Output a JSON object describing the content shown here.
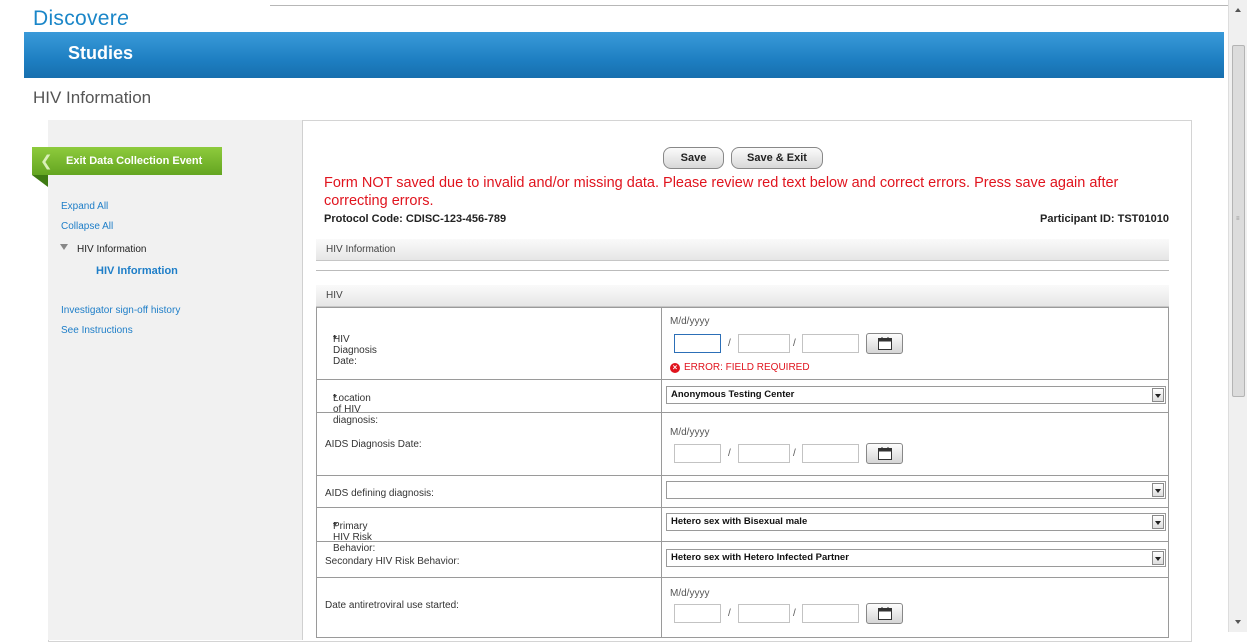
{
  "app": {
    "logo_main": "Discover",
    "logo_accent": "e",
    "banner_title": "Studies"
  },
  "page": {
    "title": "HIV Information"
  },
  "sidebar": {
    "exit_button": "Exit Data Collection Event",
    "expand_all": "Expand All",
    "collapse_all": "Collapse All",
    "tree_parent": "HIV Information",
    "tree_child": "HIV Information",
    "signoff_history": "Investigator sign-off history",
    "see_instructions": "See Instructions"
  },
  "toolbar": {
    "save_label": "Save",
    "save_exit_label": "Save & Exit"
  },
  "message": {
    "error": "Form NOT saved due to invalid and/or missing data. Please review red text below and correct errors. Press save again after correcting errors."
  },
  "header": {
    "protocol": "Protocol Code: CDISC-123-456-789",
    "participant": "Participant ID: TST01010"
  },
  "sections": {
    "main": "HIV Information",
    "sub": "HIV"
  },
  "form": {
    "date_format": "M/d/yyyy",
    "error_required": "ERROR: FIELD REQUIRED",
    "fields": [
      {
        "label": "HIV Diagnosis Date:",
        "required": true,
        "type": "date"
      },
      {
        "label": "Location of HIV diagnosis:",
        "required": true,
        "type": "select",
        "value": "Anonymous Testing Center"
      },
      {
        "label": "AIDS Diagnosis Date:",
        "required": false,
        "type": "date"
      },
      {
        "label": "AIDS defining diagnosis:",
        "required": false,
        "type": "select",
        "value": ""
      },
      {
        "label": "Primary HIV Risk Behavior:",
        "required": true,
        "type": "select",
        "value": "Hetero sex with Bisexual male"
      },
      {
        "label": "Secondary HIV Risk Behavior:",
        "required": false,
        "type": "select",
        "value": "Hetero sex with Hetero Infected Partner"
      },
      {
        "label": "Date antiretroviral use started:",
        "required": false,
        "type": "date"
      }
    ]
  },
  "colors": {
    "brand_blue": "#1e7fc2",
    "exit_green": "#64a521",
    "error_red": "#e0141e",
    "link_blue": "#1e7ec8"
  },
  "icons": {
    "calendar": "calendar-icon",
    "error": "error-icon",
    "back": "chevron-left-icon",
    "dropdown": "chevron-down-icon"
  }
}
